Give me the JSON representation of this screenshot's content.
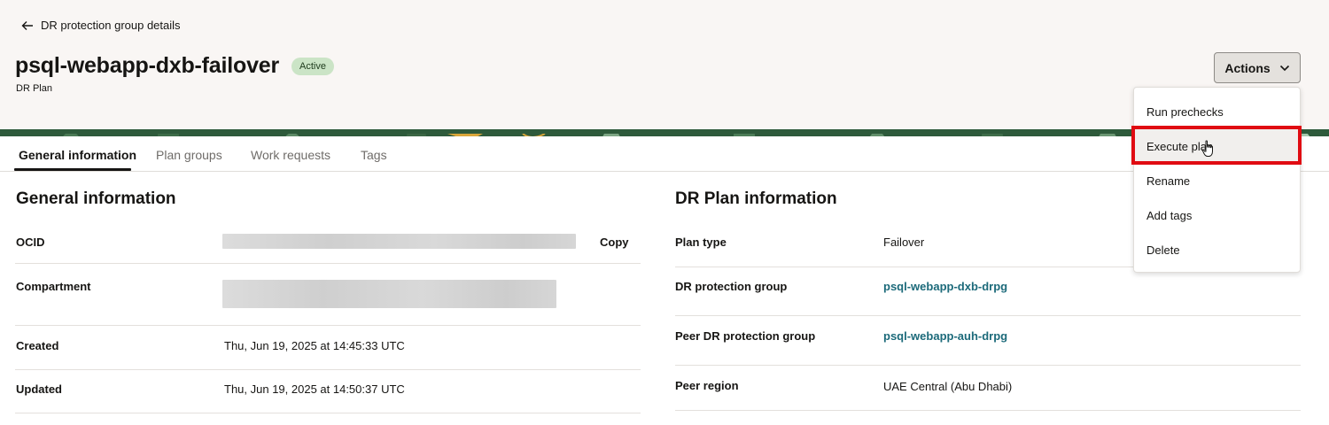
{
  "header": {
    "back_label": "DR protection group details",
    "title": "psql-webapp-dxb-failover",
    "status": "Active",
    "subtitle": "DR Plan",
    "actions_label": "Actions"
  },
  "tabs": [
    {
      "label": "General information",
      "active": true
    },
    {
      "label": "Plan groups",
      "active": false
    },
    {
      "label": "Work requests",
      "active": false
    },
    {
      "label": "Tags",
      "active": false
    }
  ],
  "general_info": {
    "title": "General information",
    "ocid_label": "OCID",
    "copy_label": "Copy",
    "compartment_label": "Compartment",
    "created_label": "Created",
    "created_value": "Thu, Jun 19, 2025 at 14:45:33 UTC",
    "updated_label": "Updated",
    "updated_value": "Thu, Jun 19, 2025 at 14:50:37 UTC"
  },
  "plan_info": {
    "title": "DR Plan information",
    "plan_type_label": "Plan type",
    "plan_type_value": "Failover",
    "protection_group_label": "DR protection group",
    "protection_group_value": "psql-webapp-dxb-drpg",
    "peer_group_label": "Peer DR protection group",
    "peer_group_value": "psql-webapp-auh-drpg",
    "peer_region_label": "Peer region",
    "peer_region_value": "UAE Central (Abu Dhabi)"
  },
  "actions_menu": {
    "items": [
      {
        "label": "Run prechecks"
      },
      {
        "label": "Execute plan"
      },
      {
        "label": "Rename"
      },
      {
        "label": "Add tags"
      },
      {
        "label": "Delete"
      }
    ]
  },
  "colors": {
    "accent_red": "#e00b12",
    "link_teal": "#1c6a7a",
    "active_badge": "#cbe4c6",
    "banner_green": "#2e5a3b"
  }
}
